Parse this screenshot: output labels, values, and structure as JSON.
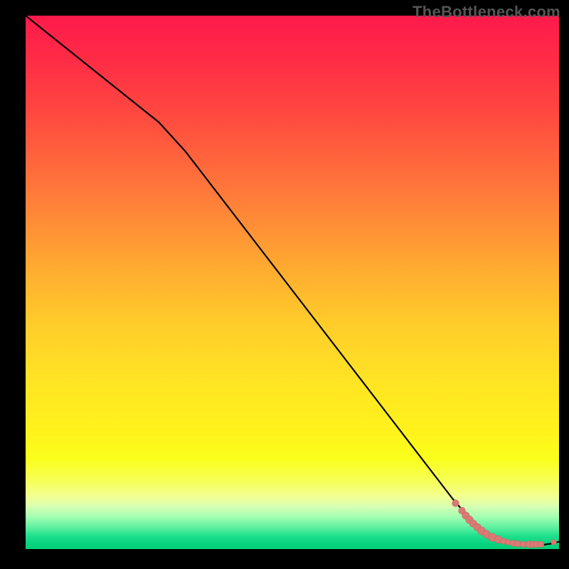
{
  "watermark": "TheBottleneck.com",
  "colors": {
    "curve": "#000000",
    "point_fill": "#d97a75",
    "point_stroke": "#c86760",
    "bg_black": "#000000"
  },
  "chart_data": {
    "type": "line",
    "title": "",
    "xlabel": "",
    "ylabel": "",
    "xlim": [
      0,
      100
    ],
    "ylim": [
      0,
      100
    ],
    "series": [
      {
        "name": "bottleneck-curve",
        "x": [
          0,
          5,
          10,
          15,
          20,
          25,
          30,
          35,
          40,
          45,
          50,
          55,
          60,
          65,
          70,
          75,
          80,
          83,
          85,
          87,
          89,
          91,
          93,
          95,
          97,
          99,
          100
        ],
        "y": [
          100,
          96,
          92,
          88,
          84,
          80,
          74.5,
          68,
          61.5,
          55,
          48.5,
          42,
          35.5,
          29,
          22.5,
          16,
          9.5,
          6,
          4,
          2.6,
          1.8,
          1.3,
          1.0,
          0.9,
          0.8,
          1.1,
          1.4
        ]
      }
    ],
    "scatter": {
      "name": "highlight-points",
      "x": [
        80.6,
        81.8,
        82.5,
        83.2,
        83.9,
        84.7,
        85.5,
        86.4,
        87.5,
        88.6,
        89.6,
        90.4,
        91.4,
        92.2,
        93.3,
        94.4,
        95.2,
        95.8,
        96.6,
        99.0
      ],
      "y": [
        8.6,
        7.2,
        6.3,
        5.5,
        4.8,
        4.1,
        3.4,
        2.8,
        2.2,
        1.8,
        1.5,
        1.3,
        1.1,
        1.0,
        0.9,
        0.9,
        0.9,
        0.9,
        0.9,
        1.3
      ],
      "r": [
        4.8,
        4.8,
        5.1,
        5.3,
        5.1,
        5.1,
        5.6,
        5.3,
        5.8,
        5.3,
        4.3,
        4.0,
        4.3,
        4.6,
        4.3,
        4.8,
        4.6,
        4.3,
        4.3,
        3.8
      ]
    }
  }
}
